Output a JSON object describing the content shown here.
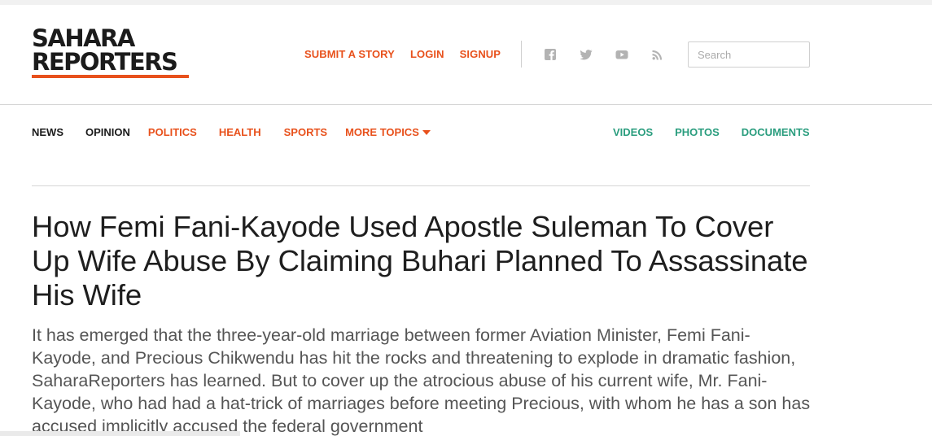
{
  "brand": {
    "logo_line1": "SAHARA",
    "logo_line2": "REPORTERS",
    "accent_color": "#e8511c",
    "media_color": "#2a9d7e"
  },
  "header": {
    "links": [
      "SUBMIT A STORY",
      "LOGIN",
      "SIGNUP"
    ],
    "social_icons": [
      "facebook-icon",
      "twitter-icon",
      "youtube-icon",
      "rss-icon"
    ],
    "search": {
      "placeholder": "Search",
      "value": ""
    }
  },
  "nav": {
    "items": [
      {
        "label": "NEWS"
      },
      {
        "label": "OPINION"
      },
      {
        "label": "POLITICS"
      },
      {
        "label": "HEALTH"
      },
      {
        "label": "SPORTS"
      },
      {
        "label": "MORE TOPICS"
      }
    ],
    "media": [
      {
        "label": "VIDEOS"
      },
      {
        "label": "PHOTOS"
      },
      {
        "label": "DOCUMENTS"
      }
    ]
  },
  "article": {
    "title": "How Femi Fani-Kayode Used Apostle Suleman To Cover Up Wife Abuse By Claiming Buhari Planned To Assassinate His Wife",
    "summary": "It has emerged that the three-year-old marriage between former Aviation Minister, Femi Fani-Kayode, and Precious Chikwendu has hit the rocks and threatening to explode in dramatic fashion, SaharaReporters has learned. But to cover up the atrocious abuse of his current wife,  Mr. Fani-Kayode, who had had a hat-trick of marriages before meeting Precious, with whom he has a son has accused implicitly accused the federal government"
  }
}
